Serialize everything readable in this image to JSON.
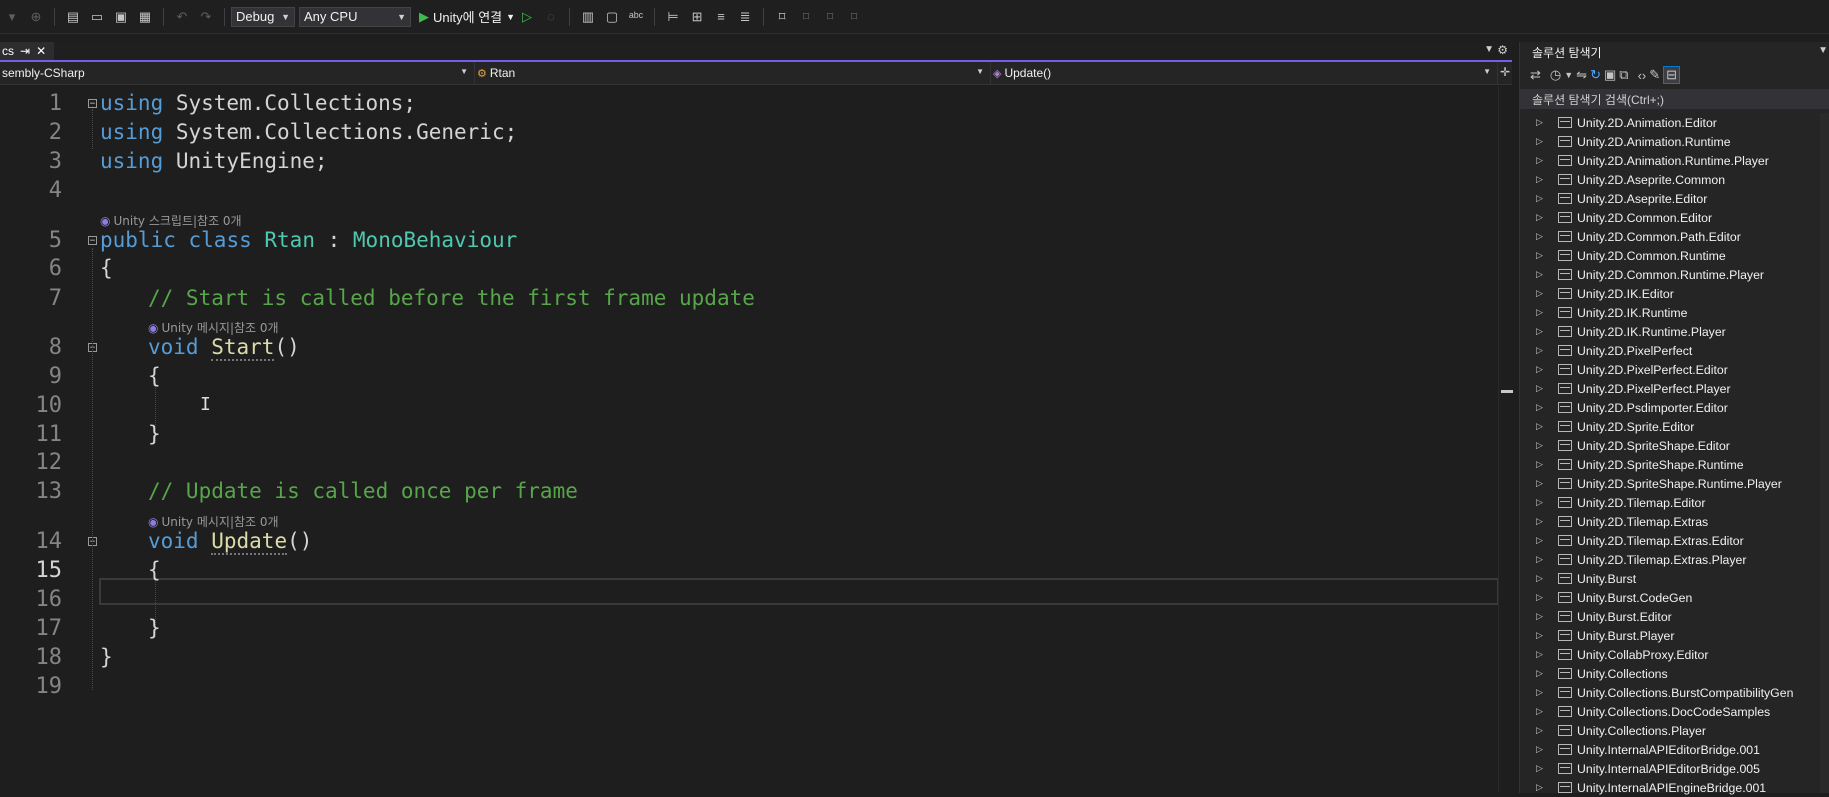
{
  "toolbar": {
    "config": "Debug",
    "platform": "Any CPU",
    "run_label": "Unity에 연결"
  },
  "tab": {
    "label": "cs",
    "pin": "⇥",
    "close": "✕"
  },
  "navbar": {
    "project": "sembly-CSharp",
    "class": "Rtan",
    "member": "Update()"
  },
  "code": {
    "line_numbers": [
      "1",
      "2",
      "3",
      "4",
      "5",
      "6",
      "7",
      "8",
      "9",
      "10",
      "11",
      "12",
      "13",
      "14",
      "15",
      "16",
      "17",
      "18",
      "19"
    ],
    "l1a": "using",
    "l1b": " System.Collections;",
    "l2a": "using",
    "l2b": " System.Collections.Generic;",
    "l3a": "using",
    "l3b": " UnityEngine;",
    "lens_class": "Unity 스크립트|참조 0개",
    "l5a": "public",
    "l5b": "class",
    "l5c": "Rtan",
    "l5d": " : ",
    "l5e": "MonoBehaviour",
    "l6": "{",
    "l7": "// Start is called before the first frame update",
    "lens_start": "Unity 메시지|참조 0개",
    "l8a": "void",
    "l8b": "Start",
    "l8c": "()",
    "l9": "{",
    "l11": "}",
    "l13": "// Update is called once per frame",
    "lens_update": "Unity 메시지|참조 0개",
    "l14a": "void",
    "l14b": "Update",
    "l14c": "()",
    "l15": "{",
    "l17": "}",
    "l18": "}"
  },
  "solution_explorer": {
    "title": "솔루션 탐색기",
    "search_placeholder": "솔루션 탐색기 검색(Ctrl+;)",
    "items": [
      "Unity.2D.Animation.Editor",
      "Unity.2D.Animation.Runtime",
      "Unity.2D.Animation.Runtime.Player",
      "Unity.2D.Aseprite.Common",
      "Unity.2D.Aseprite.Editor",
      "Unity.2D.Common.Editor",
      "Unity.2D.Common.Path.Editor",
      "Unity.2D.Common.Runtime",
      "Unity.2D.Common.Runtime.Player",
      "Unity.2D.IK.Editor",
      "Unity.2D.IK.Runtime",
      "Unity.2D.IK.Runtime.Player",
      "Unity.2D.PixelPerfect",
      "Unity.2D.PixelPerfect.Editor",
      "Unity.2D.PixelPerfect.Player",
      "Unity.2D.Psdimporter.Editor",
      "Unity.2D.Sprite.Editor",
      "Unity.2D.SpriteShape.Editor",
      "Unity.2D.SpriteShape.Runtime",
      "Unity.2D.SpriteShape.Runtime.Player",
      "Unity.2D.Tilemap.Editor",
      "Unity.2D.Tilemap.Extras",
      "Unity.2D.Tilemap.Extras.Editor",
      "Unity.2D.Tilemap.Extras.Player",
      "Unity.Burst",
      "Unity.Burst.CodeGen",
      "Unity.Burst.Editor",
      "Unity.Burst.Player",
      "Unity.CollabProxy.Editor",
      "Unity.Collections",
      "Unity.Collections.BurstCompatibilityGen",
      "Unity.Collections.DocCodeSamples",
      "Unity.Collections.Player",
      "Unity.InternalAPIEditorBridge.001",
      "Unity.InternalAPIEditorBridge.005",
      "Unity.InternalAPIEngineBridge.001"
    ]
  }
}
